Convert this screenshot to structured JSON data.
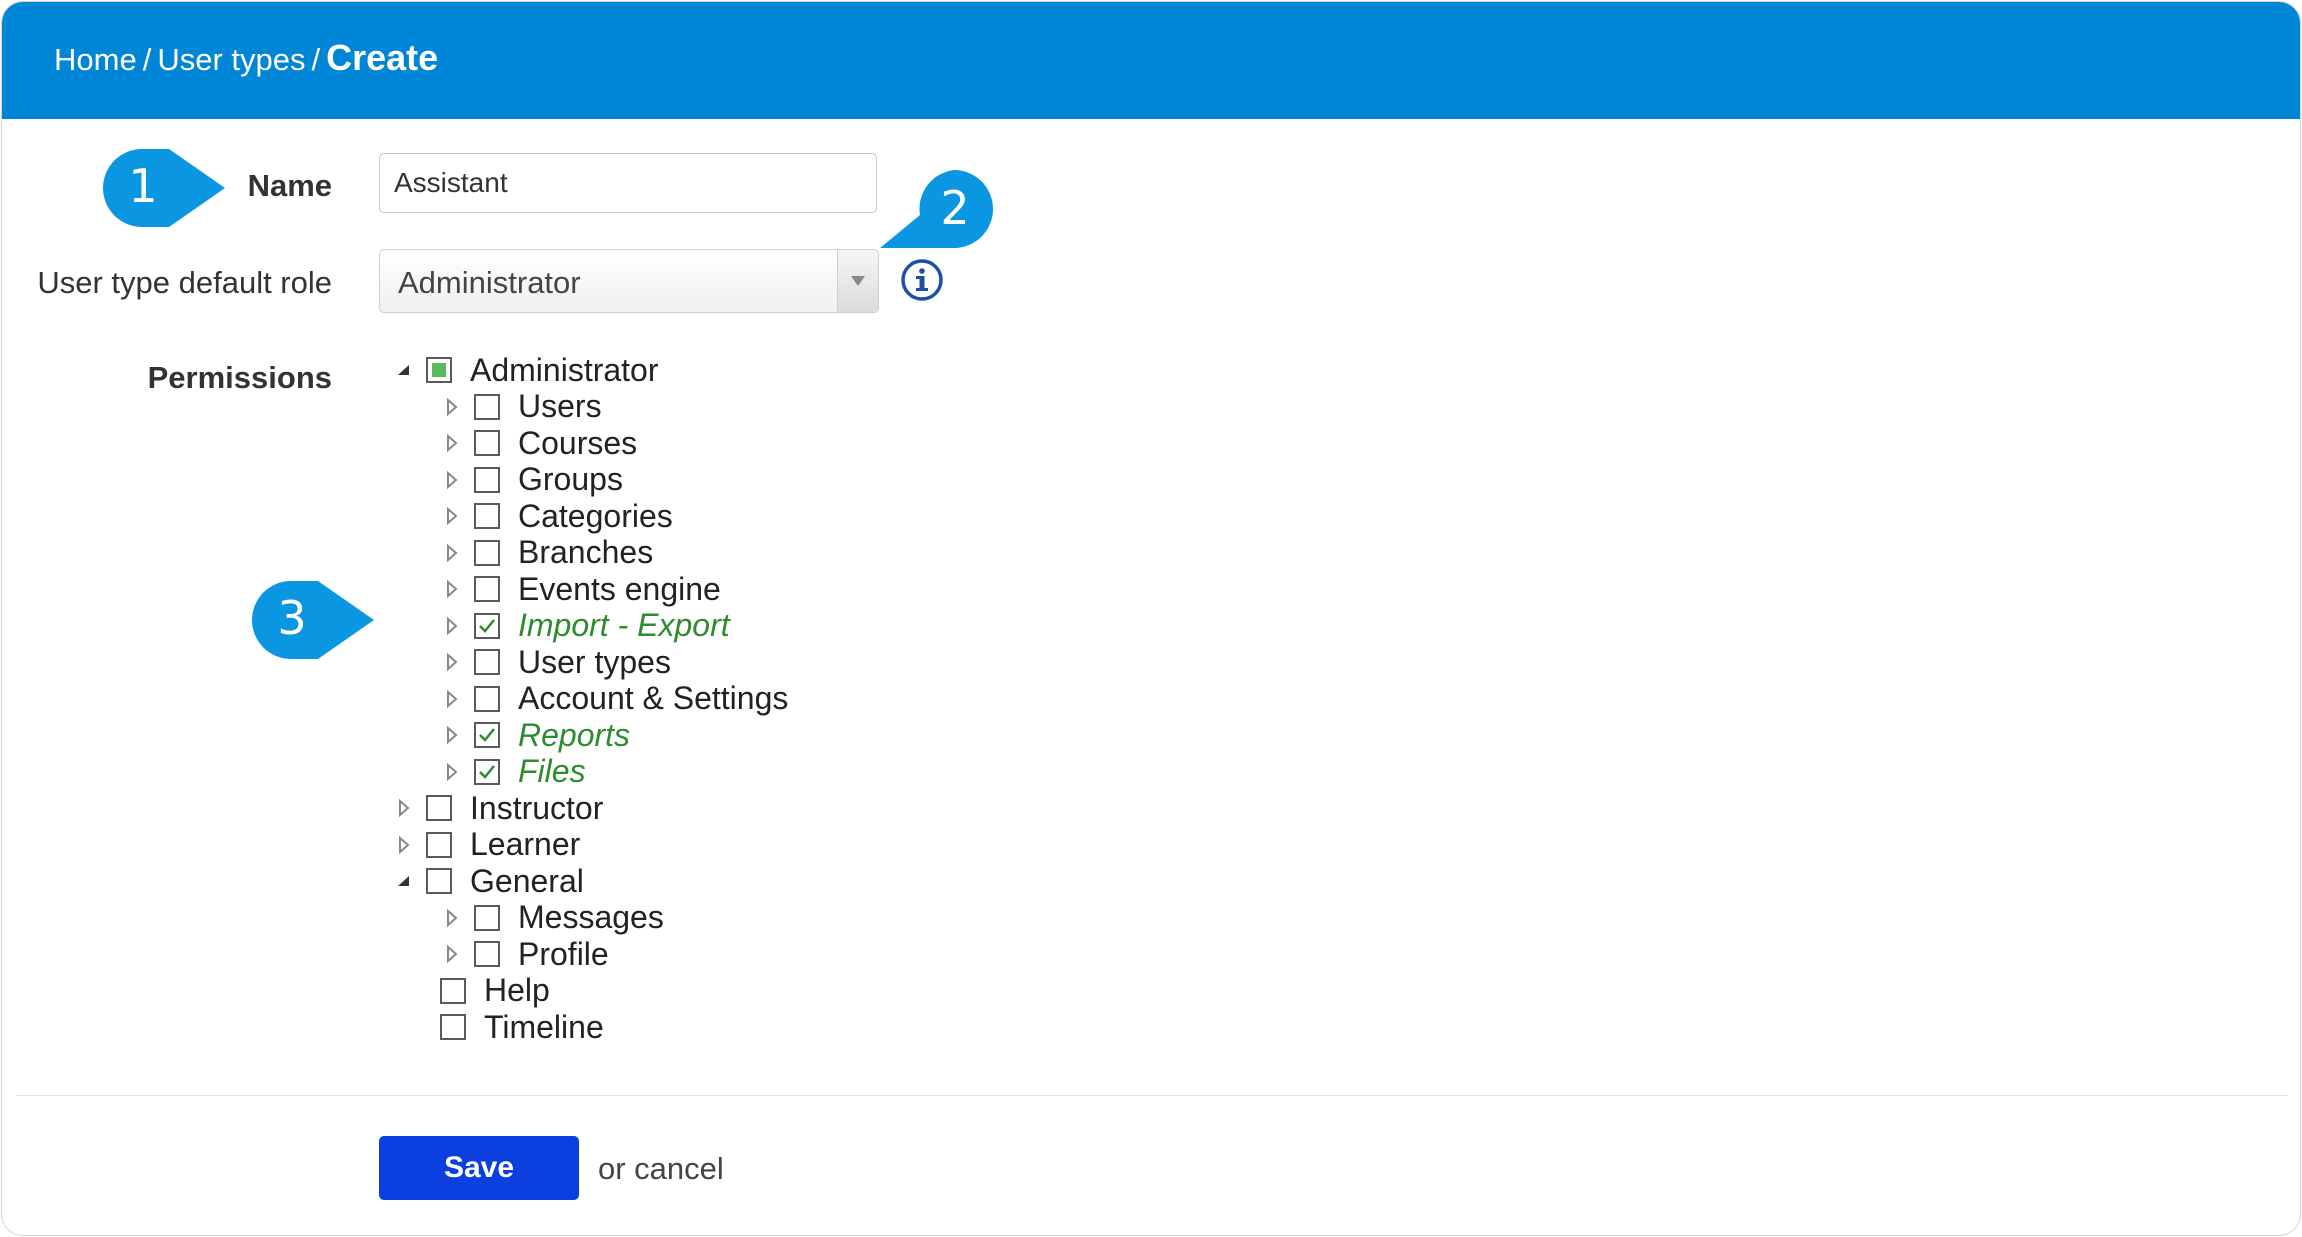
{
  "breadcrumb": {
    "home": "Home",
    "separator": "/",
    "user_types": "User types",
    "current": "Create"
  },
  "form": {
    "name_label": "Name",
    "name_value": "Assistant",
    "role_label": "User type default role",
    "role_value": "Administrator",
    "permissions_label": "Permissions"
  },
  "icons": {
    "info": "info-icon",
    "select_arrow": "chevron-down-icon"
  },
  "callouts": [
    "1",
    "2",
    "3"
  ],
  "permissions": [
    {
      "label": "Administrator",
      "level": 0,
      "toggle": "expanded",
      "state": "partial"
    },
    {
      "label": "Users",
      "level": 1,
      "toggle": "collapsed",
      "state": "unchecked"
    },
    {
      "label": "Courses",
      "level": 1,
      "toggle": "collapsed",
      "state": "unchecked"
    },
    {
      "label": "Groups",
      "level": 1,
      "toggle": "collapsed",
      "state": "unchecked"
    },
    {
      "label": "Categories",
      "level": 1,
      "toggle": "collapsed",
      "state": "unchecked"
    },
    {
      "label": "Branches",
      "level": 1,
      "toggle": "collapsed",
      "state": "unchecked"
    },
    {
      "label": "Events engine",
      "level": 1,
      "toggle": "collapsed",
      "state": "unchecked"
    },
    {
      "label": "Import - Export",
      "level": 1,
      "toggle": "collapsed",
      "state": "checked"
    },
    {
      "label": "User types",
      "level": 1,
      "toggle": "collapsed",
      "state": "unchecked"
    },
    {
      "label": "Account & Settings",
      "level": 1,
      "toggle": "collapsed",
      "state": "unchecked"
    },
    {
      "label": "Reports",
      "level": 1,
      "toggle": "collapsed",
      "state": "checked"
    },
    {
      "label": "Files",
      "level": 1,
      "toggle": "collapsed",
      "state": "checked"
    },
    {
      "label": "Instructor",
      "level": 0,
      "toggle": "collapsed",
      "state": "unchecked"
    },
    {
      "label": "Learner",
      "level": 0,
      "toggle": "collapsed",
      "state": "unchecked"
    },
    {
      "label": "General",
      "level": 0,
      "toggle": "expanded",
      "state": "unchecked"
    },
    {
      "label": "Messages",
      "level": 1,
      "toggle": "collapsed",
      "state": "unchecked"
    },
    {
      "label": "Profile",
      "level": 1,
      "toggle": "collapsed",
      "state": "unchecked"
    },
    {
      "label": "Help",
      "level": 1,
      "toggle": "none",
      "state": "unchecked"
    },
    {
      "label": "Timeline",
      "level": 1,
      "toggle": "none",
      "state": "unchecked"
    }
  ],
  "footer": {
    "save_label": "Save",
    "cancel_text": "or cancel"
  },
  "colors": {
    "header": "#0086d6",
    "callout": "#0a96e0",
    "save_button": "#0b3fe0",
    "checked_text": "#2e8b2e",
    "info_icon": "#1f4ea8"
  }
}
